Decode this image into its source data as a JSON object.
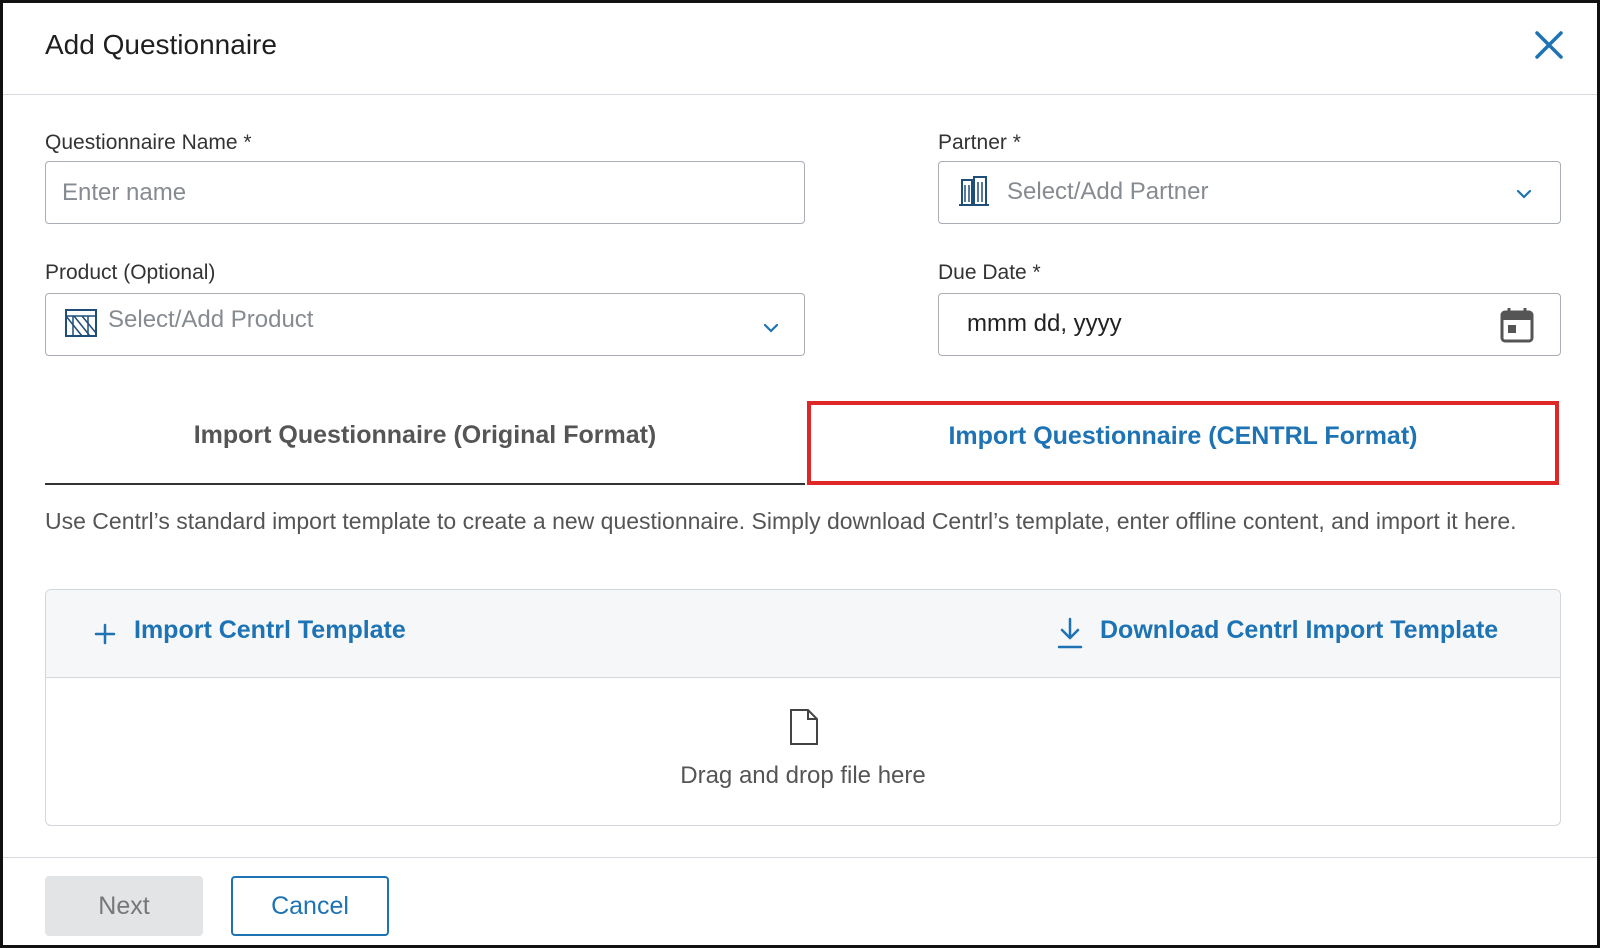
{
  "modal": {
    "title": "Add Questionnaire",
    "close_icon": "close-icon"
  },
  "form": {
    "name": {
      "label": "Questionnaire Name *",
      "placeholder": "Enter name",
      "value": ""
    },
    "partner": {
      "label": "Partner *",
      "placeholder": "Select/Add Partner",
      "icon": "building-icon"
    },
    "product": {
      "label": "Product (Optional)",
      "placeholder": "Select/Add Product",
      "icon": "product-icon"
    },
    "due_date": {
      "label": "Due Date *",
      "value": "mmm dd, yyyy",
      "icon": "calendar-icon"
    }
  },
  "tabs": [
    {
      "label": "Import Questionnaire (Original Format)",
      "active": false
    },
    {
      "label": "Import Questionnaire (CENTRL Format)",
      "active": true
    }
  ],
  "description": "Use Centrl’s standard import template to create a new questionnaire. Simply download Centrl’s template, enter offline content, and import it here.",
  "dropzone": {
    "import_label": "Import Centrl Template",
    "download_label": "Download Centrl Import Template",
    "drop_text": "Drag and drop file here"
  },
  "footer": {
    "next_label": "Next",
    "cancel_label": "Cancel"
  },
  "colors": {
    "accent": "#1d73b3",
    "highlight": "#e02727",
    "disabled": "#e3e4e6"
  }
}
